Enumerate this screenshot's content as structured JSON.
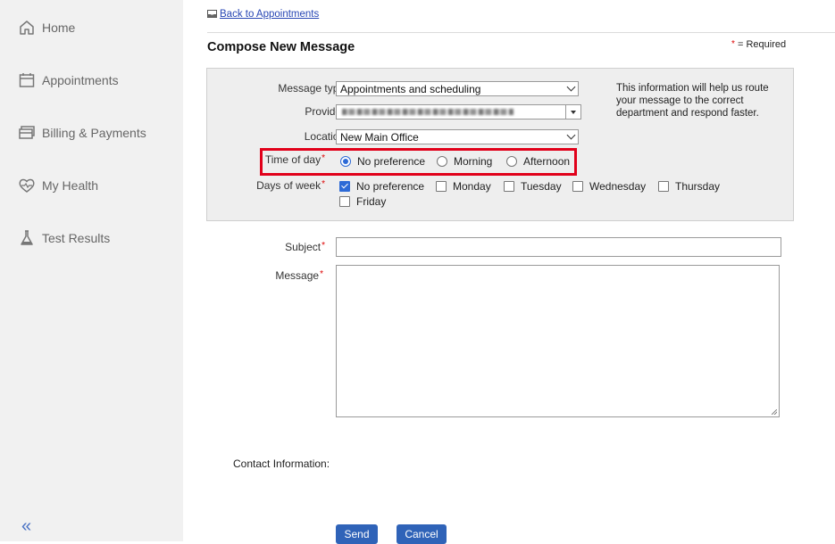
{
  "sidebar": {
    "items": [
      {
        "label": "Home",
        "icon": "home-icon"
      },
      {
        "label": "Appointments",
        "icon": "calendar-icon"
      },
      {
        "label": "Billing & Payments",
        "icon": "billing-icon"
      },
      {
        "label": "My Health",
        "icon": "heart-icon"
      },
      {
        "label": "Test Results",
        "icon": "flask-icon"
      }
    ],
    "collapse_label": "«"
  },
  "header": {
    "back_link": "Back to Appointments",
    "title": "Compose New Message",
    "required_note": "= Required",
    "required_marker": "*"
  },
  "form": {
    "message_type": {
      "label": "Message type",
      "value": "Appointments and scheduling"
    },
    "provider": {
      "label": "Provider",
      "value": ""
    },
    "location": {
      "label": "Location",
      "value": "New Main Office"
    },
    "info_text": "This information will help us route your message to the correct department and respond faster.",
    "time_of_day": {
      "label": "Time of day",
      "options": [
        {
          "label": "No preference",
          "selected": true
        },
        {
          "label": "Morning",
          "selected": false
        },
        {
          "label": "Afternoon",
          "selected": false
        }
      ]
    },
    "days_of_week": {
      "label": "Days of week",
      "options": [
        {
          "label": "No preference",
          "checked": true
        },
        {
          "label": "Monday",
          "checked": false
        },
        {
          "label": "Tuesday",
          "checked": false
        },
        {
          "label": "Wednesday",
          "checked": false
        },
        {
          "label": "Thursday",
          "checked": false
        },
        {
          "label": "Friday",
          "checked": false
        }
      ]
    },
    "subject": {
      "label": "Subject",
      "value": ""
    },
    "message": {
      "label": "Message",
      "value": ""
    },
    "contact_label": "Contact Information:"
  },
  "actions": {
    "send": "Send",
    "cancel": "Cancel"
  },
  "colors": {
    "accent": "#2f63b8",
    "highlight": "#e1001a",
    "required": "#dd0000"
  }
}
